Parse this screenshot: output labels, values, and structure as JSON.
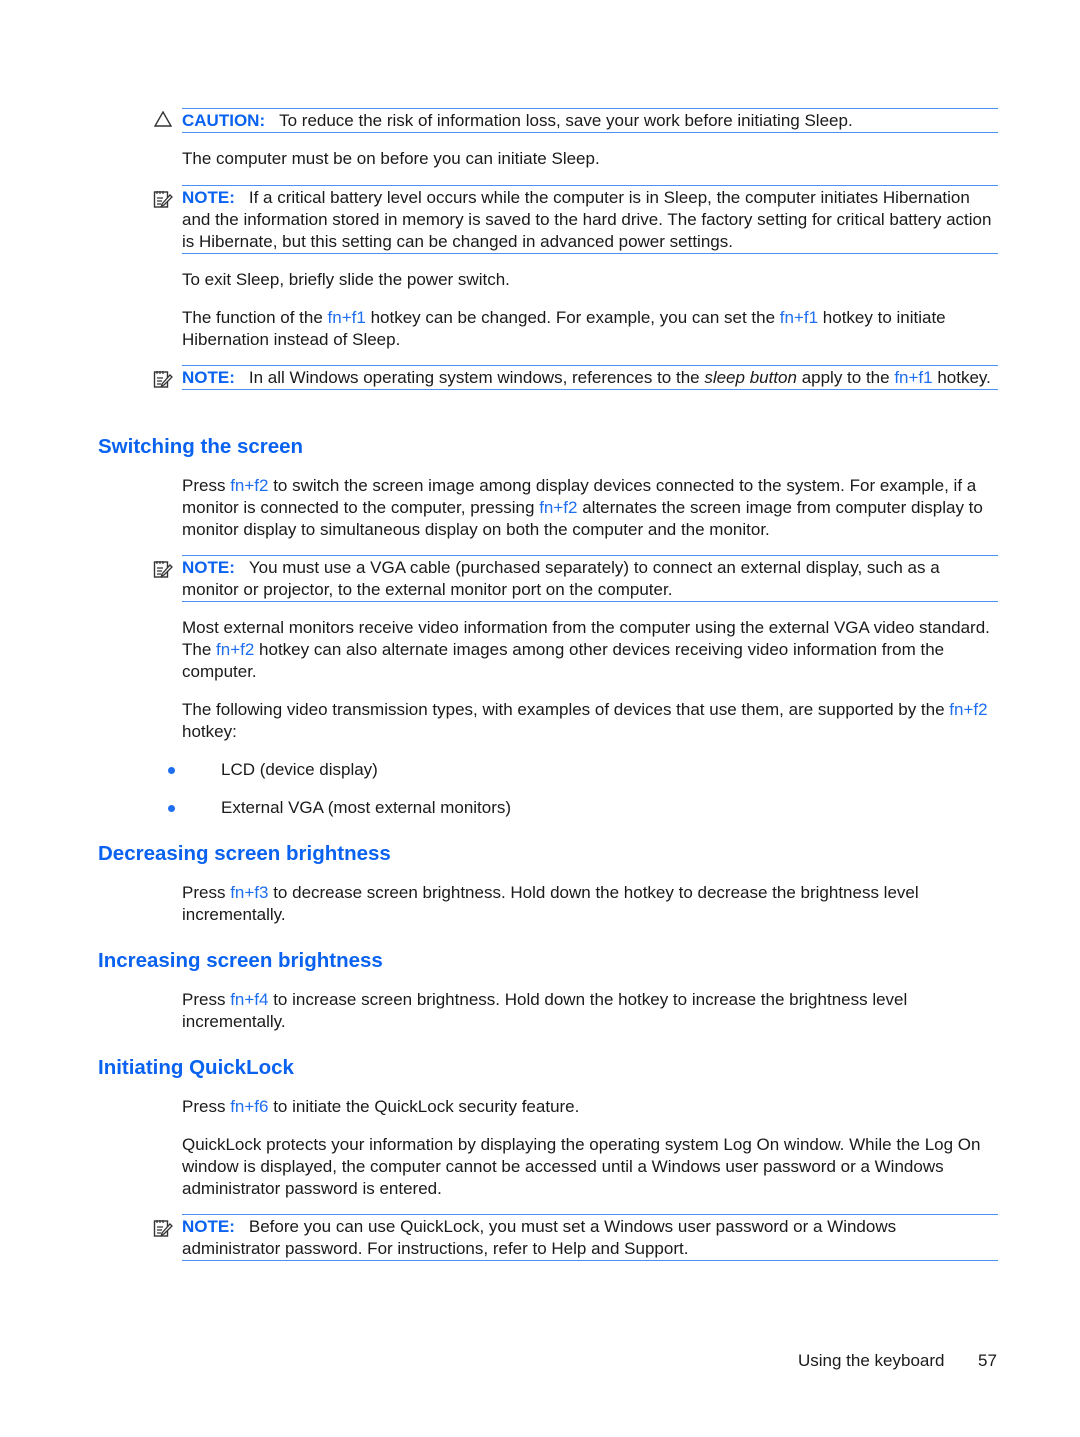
{
  "colors": {
    "accent": "#0a62f0",
    "link": "#1e6ef0",
    "rule": "#4a8ff2",
    "text": "#1a1a1a"
  },
  "caution": {
    "icon": "warning-triangle-icon",
    "label": "CAUTION:",
    "text": "To reduce the risk of information loss, save your work before initiating Sleep."
  },
  "p_must_be_on": "The computer must be on before you can initiate Sleep.",
  "note1": {
    "icon": "note-pencil-icon",
    "label": "NOTE:",
    "text": "If a critical battery level occurs while the computer is in Sleep, the computer initiates Hibernation and the information stored in memory is saved to the hard drive. The factory setting for critical battery action is Hibernate, but this setting can be changed in advanced power settings."
  },
  "p_exit_sleep": "To exit Sleep, briefly slide the power switch.",
  "p_function": {
    "t1": "The function of the ",
    "k1": "fn+f1",
    "t2": " hotkey can be changed. For example, you can set the ",
    "k2": "fn+f1",
    "t3": " hotkey to initiate Hibernation instead of Sleep."
  },
  "note2": {
    "label": "NOTE:",
    "t1": "In all Windows operating system windows, references to the ",
    "em": "sleep button",
    "t2": " apply to the ",
    "k1": "fn+f1",
    "t3": " hotkey."
  },
  "sections": {
    "switching": {
      "title": "Switching the screen",
      "p1": {
        "t1": "Press ",
        "k1": "fn+f2",
        "t2": " to switch the screen image among display devices connected to the system. For example, if a monitor is connected to the computer, pressing ",
        "k2": "fn+f2",
        "t3": " alternates the screen image from computer display to monitor display to simultaneous display on both the computer and the monitor."
      },
      "note": {
        "label": "NOTE:",
        "text": "You must use a VGA cable (purchased separately) to connect an external display, such as a monitor or projector, to the external monitor port on the computer."
      },
      "p2": {
        "t1": "Most external monitors receive video information from the computer using the external VGA video standard. The ",
        "k1": "fn+f2",
        "t2": " hotkey can also alternate images among other devices receiving video information from the computer."
      },
      "p3": {
        "t1": "The following video transmission types, with examples of devices that use them, are supported by the ",
        "k1": "fn+f2",
        "t2": " hotkey:"
      },
      "bullets": [
        "LCD (device display)",
        "External VGA (most external monitors)"
      ]
    },
    "decreasing": {
      "title": "Decreasing screen brightness",
      "p1": {
        "t1": "Press ",
        "k1": "fn+f3",
        "t2": " to decrease screen brightness. Hold down the hotkey to decrease the brightness level incrementally."
      }
    },
    "increasing": {
      "title": "Increasing screen brightness",
      "p1": {
        "t1": "Press ",
        "k1": "fn+f4",
        "t2": " to increase screen brightness. Hold down the hotkey to increase the brightness level incrementally."
      }
    },
    "quicklock": {
      "title": "Initiating QuickLock",
      "p1": {
        "t1": "Press ",
        "k1": "fn+f6",
        "t2": " to initiate the QuickLock security feature."
      },
      "p2": "QuickLock protects your information by displaying the operating system Log On window. While the Log On window is displayed, the computer cannot be accessed until a Windows user password or a Windows administrator password is entered.",
      "note": {
        "label": "NOTE:",
        "text": "Before you can use QuickLock, you must set a Windows user password or a Windows administrator password. For instructions, refer to Help and Support."
      }
    }
  },
  "footer": {
    "chapter": "Using the keyboard",
    "page": "57"
  }
}
